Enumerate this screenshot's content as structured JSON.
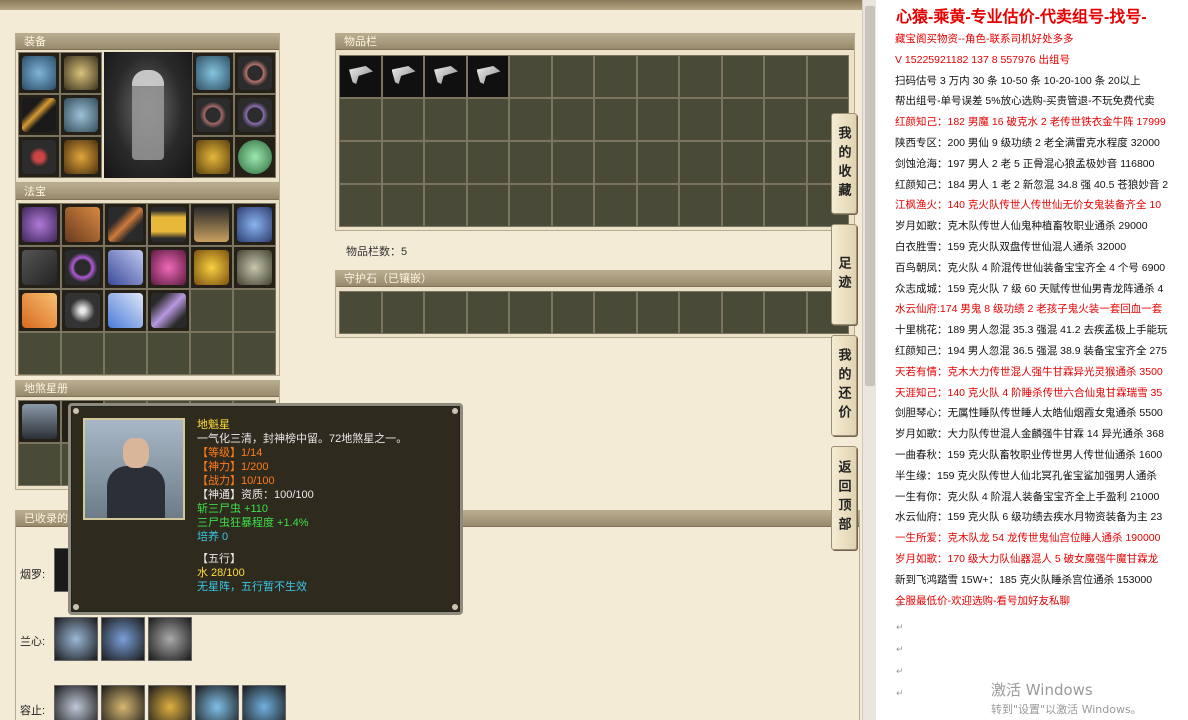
{
  "game": {
    "equip_title": "装备",
    "fabao_title": "法宝",
    "disha_title": "地煞星册",
    "inventory_title": "物品栏",
    "inventory_count": "物品栏数：5",
    "guardian_title": "守护石（已镶嵌）",
    "collected_title": "已收录的",
    "pet_rows": [
      "烟罗:",
      "兰心:",
      "容止:"
    ],
    "side_buttons": [
      "我的收藏",
      "足迹",
      "我的还价",
      "返回顶部"
    ]
  },
  "tooltip": {
    "name": "地魁星",
    "desc": "一气化三清，封神榜中留。72地煞星之一。",
    "level": "【等级】1/14",
    "shenli": "【神力】1/200",
    "zhanli": "【战力】10/100",
    "shentong": "【神通】资质：100/100",
    "shi_san": "斩三尸虫 +110",
    "san_shi": "三尸虫狂暴程度 +1.4%",
    "peiyang": "培养 0",
    "wuxing_head": "【五行】",
    "wuxing_val": "水 28/100",
    "wuxing_note": "无星阵，五行暂不生效"
  },
  "doc": {
    "title": "心猿-乘黄-专业估价-代卖组号-找号-",
    "lines": [
      {
        "text": "藏宝阁买物资--角色-联系司机好处多多",
        "color": "red"
      },
      {
        "text": "V 15225921182  137 8 557976   出组号",
        "color": "red"
      },
      {
        "text": "扫码估号 3 万内 30 条  10-50 条  10-20-100 条 20以上",
        "color": "black"
      },
      {
        "text": "帮出组号-单号误差 5%放心选购-买贵管退-不玩免费代卖",
        "color": "black"
      },
      {
        "text": "红颜知己：182 男魔 16 破克水 2 老传世铁衣金牛阵 17999",
        "color": "red"
      },
      {
        "text": "陕西专区：200 男仙 9 级功绩 2 老全满雷克水程度 32000",
        "color": "black"
      },
      {
        "text": "剑蚀沧海：197 男人 2 老 5 正骨混心狼孟极妙音 116800",
        "color": "black"
      },
      {
        "text": "红颜知己：184 男人 1 老 2 新忽混 34.8 强 40.5 苍狼妙音 2",
        "color": "black"
      },
      {
        "text": "江枫渔火：140 克火队传世人传世仙无价女鬼装备齐全 10",
        "color": "red"
      },
      {
        "text": "岁月如歌：克木队传世人仙鬼种植畜牧职业通杀 29000",
        "color": "black"
      },
      {
        "text": "白衣胜雪：159 克火队双盘传世仙混人通杀 32000",
        "color": "black"
      },
      {
        "text": "百鸟朝凤：克火队 4 阶混传世仙装备宝宝齐全 4 个号 6900",
        "color": "black"
      },
      {
        "text": "众志成城：159 克火队 7 级 60 天赋传世仙男青龙阵通杀 4",
        "color": "black"
      },
      {
        "text": "水云仙府:174 男鬼 8 级功绩 2 老孩子鬼火装一套回血一套",
        "color": "red"
      },
      {
        "text": "十里桃花：189 男人忽混 35.3 强混 41.2 去疾孟极上手能玩",
        "color": "black"
      },
      {
        "text": "红颜知己：194 男人忽混 36.5 强混 38.9 装备宝宝齐全 275",
        "color": "black"
      },
      {
        "text": "天若有情：克木大力传世混人强牛甘霖异光灵猴通杀 3500",
        "color": "red"
      },
      {
        "text": "天涯知己：140 克火队 4 阶睡杀传世六合仙鬼甘霖瑞雪 35",
        "color": "red"
      },
      {
        "text": "剑胆琴心：无属性睡队传世睡人太皓仙烟霞女鬼通杀 5500",
        "color": "black"
      },
      {
        "text": "岁月如歌：大力队传世混人金麟强牛甘霖 14 异光通杀 368",
        "color": "black"
      },
      {
        "text": "一曲春秋：159 克火队畜牧职业传世男人传世仙通杀 1600",
        "color": "black"
      },
      {
        "text": "半生缘：159 克火队传世人仙北冥孔雀宝鲨加强男人通杀",
        "color": "black"
      },
      {
        "text": "一生有你：克火队 4 阶混人装备宝宝齐全上手盈利 21000",
        "color": "black"
      },
      {
        "text": "水云仙府：159 克火队 6 级功绩去疾水月物资装备为主 23",
        "color": "black"
      },
      {
        "text": "一生所爱：克木队龙 54 龙传世鬼仙宫位睡人通杀 190000",
        "color": "red"
      },
      {
        "text": "岁月如歌：170 级大力队仙器混人 5 破女魔强牛魔甘霖龙",
        "color": "red"
      },
      {
        "text": "新到飞鸿踏雪 15W+：185 克火队睡杀宫位通杀 153000",
        "color": "black"
      },
      {
        "text": "全服最低价-欢迎选购-看号加好友私聊",
        "color": "red"
      }
    ],
    "watermark_1": "激活 Windows",
    "watermark_2": "转到\"设置\"以激活 Windows。"
  }
}
